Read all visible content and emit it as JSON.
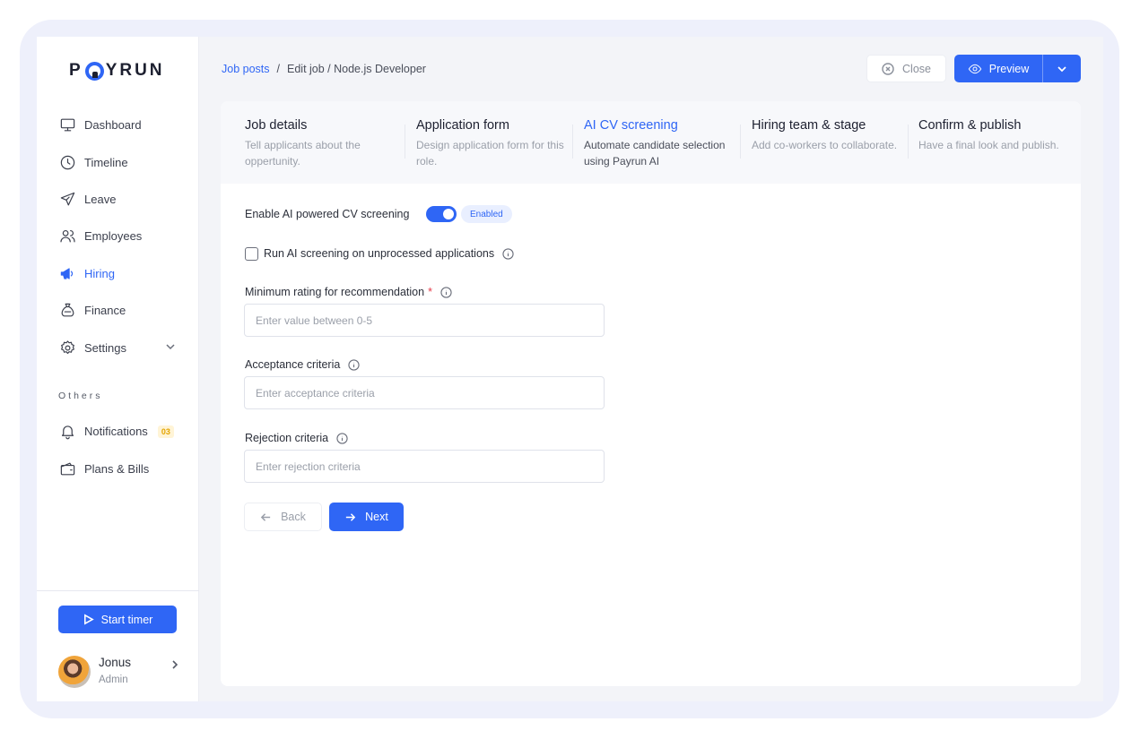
{
  "brand": {
    "logo_text": "PAYRUN"
  },
  "sidebar": {
    "items": [
      {
        "label": "Dashboard",
        "icon": "monitor-icon"
      },
      {
        "label": "Timeline",
        "icon": "clock-icon"
      },
      {
        "label": "Leave",
        "icon": "plane-icon"
      },
      {
        "label": "Employees",
        "icon": "users-icon"
      },
      {
        "label": "Hiring",
        "icon": "megaphone-icon",
        "active": true
      },
      {
        "label": "Finance",
        "icon": "money-bag-icon"
      },
      {
        "label": "Settings",
        "icon": "gear-icon"
      }
    ],
    "others_label": "Others",
    "others": [
      {
        "label": "Notifications",
        "icon": "bell-icon",
        "badge": "03"
      },
      {
        "label": "Plans & Bills",
        "icon": "wallet-icon"
      }
    ],
    "timer_label": "Start timer",
    "user": {
      "name": "Jonus",
      "role": "Admin"
    }
  },
  "header": {
    "breadcrumb": {
      "root": "Job posts",
      "separator": "/",
      "current": "Edit job / Node.js Developer"
    },
    "close_label": "Close",
    "preview_label": "Preview"
  },
  "steps": [
    {
      "title": "Job details",
      "desc": "Tell applicants about the oppertunity."
    },
    {
      "title": "Application form",
      "desc": "Design application form for this role."
    },
    {
      "title": "AI CV screening",
      "desc": "Automate candidate selection using Payrun AI",
      "active": true
    },
    {
      "title": "Hiring team & stage",
      "desc": "Add co-workers to collaborate."
    },
    {
      "title": "Confirm & publish",
      "desc": "Have a final look and publish."
    }
  ],
  "form": {
    "enable_label": "Enable AI powered CV screening",
    "enable_state": "Enabled",
    "run_label": "Run AI screening on unprocessed applications",
    "min_rating_label": "Minimum rating for recommendation",
    "required_mark": "*",
    "min_rating_placeholder": "Enter value between 0-5",
    "acceptance_label": "Acceptance criteria",
    "acceptance_placeholder": "Enter acceptance criteria",
    "rejection_label": "Rejection criteria",
    "rejection_placeholder": "Enter rejection criteria",
    "back_label": "Back",
    "next_label": "Next"
  },
  "colors": {
    "accent": "#2f66f5",
    "required": "#e53b4a",
    "badge_bg": "#fff4d6",
    "badge_text": "#e3a400"
  }
}
